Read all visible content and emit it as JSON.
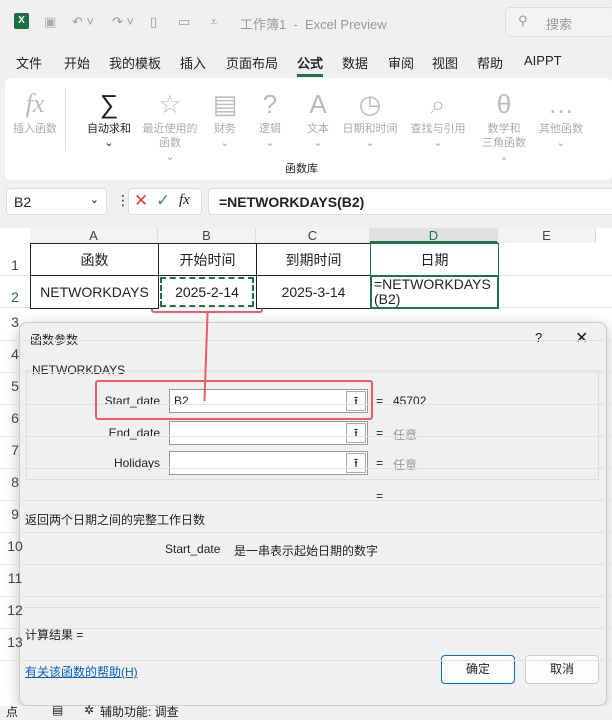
{
  "titlebar": {
    "title": "工作簿1  -  Excel Preview",
    "search_placeholder": "搜索"
  },
  "tabs": [
    "文件",
    "开始",
    "我的模板",
    "插入",
    "页面布局",
    "公式",
    "数据",
    "审阅",
    "视图",
    "帮助",
    "AIPPT"
  ],
  "active_tab": "公式",
  "ribbon": {
    "group_label": "函数库",
    "buttons": [
      {
        "label": "插入函数",
        "icon": "fx"
      },
      {
        "label": "自动求和",
        "icon": "∑"
      },
      {
        "label": "最近使用的\n函数",
        "icon": "☆"
      },
      {
        "label": "财务",
        "icon": "▤"
      },
      {
        "label": "逻辑",
        "icon": "?"
      },
      {
        "label": "文本",
        "icon": "A"
      },
      {
        "label": "日期和时间",
        "icon": "◷"
      },
      {
        "label": "查找与引用",
        "icon": "⌕"
      },
      {
        "label": "数学和\n三角函数",
        "icon": "θ"
      },
      {
        "label": "其他函数",
        "icon": "…"
      }
    ]
  },
  "formula_bar": {
    "name_box": "B2",
    "formula": "=NETWORKDAYS(B2)"
  },
  "columns": [
    "A",
    "B",
    "C",
    "D",
    "E"
  ],
  "rows": [
    "1",
    "2",
    "3",
    "4",
    "5",
    "6",
    "7",
    "8",
    "9",
    "10",
    "11",
    "12",
    "13"
  ],
  "cells": {
    "A1": "函数",
    "B1": "开始时间",
    "C1": "到期时间",
    "D1": "日期",
    "A2": "NETWORKDAYS",
    "B2": "2025-2-14",
    "C2": "2025-3-14",
    "D2": "=NETWORKDAYS\n(B2)"
  },
  "dialog": {
    "title": "函数参数",
    "help": "?",
    "function_name": "NETWORKDAYS",
    "args": [
      {
        "label": "Start_date",
        "value": "B2",
        "result": "45702"
      },
      {
        "label": "End_date",
        "value": "",
        "result": "任意"
      },
      {
        "label": "Holidays",
        "value": "",
        "result": "任意"
      }
    ],
    "eq": "=",
    "description": "返回两个日期之间的完整工作日数",
    "arg_name": "Start_date",
    "arg_desc": "是一串表示起始日期的数字",
    "result_label": "计算结果 =",
    "help_link": "有关该函数的帮助(H)",
    "ok": "确定",
    "cancel": "取消"
  },
  "statusbar": {
    "mode": "点",
    "accessibility": "辅助功能: 调查"
  },
  "colors": {
    "accent": "#217346",
    "highlight": "#ef5b6b",
    "link": "#0563c1"
  }
}
